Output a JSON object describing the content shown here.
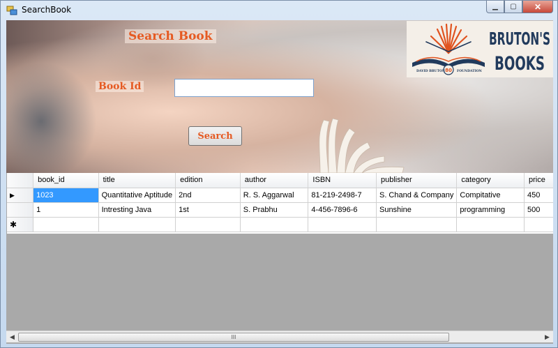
{
  "window": {
    "title": "SearchBook"
  },
  "form": {
    "heading": "Search Book",
    "book_id_label": "Book Id",
    "book_id_value": "",
    "search_label": "Search"
  },
  "logo": {
    "line1": "BRUTON'S",
    "line2": "BOOKS",
    "tagline_left": "DAVID BRUTON",
    "tagline_right": "FOUNDATION",
    "badge": "80"
  },
  "grid": {
    "columns": [
      "book_id",
      "title",
      "edition",
      "author",
      "ISBN",
      "publisher",
      "category",
      "price"
    ],
    "rows": [
      [
        "1023",
        "Quantitative Aptitude",
        "2nd",
        "R. S. Aggarwal",
        "81-219-2498-7",
        "S. Chand & Company",
        "Compitative",
        "450"
      ],
      [
        "1",
        "Intresting Java",
        "1st",
        "S. Prabhu",
        "4-456-7896-6",
        "Sunshine",
        "programming",
        "500"
      ]
    ],
    "new_row_marker": "✱",
    "current_row_marker": "▶"
  },
  "scrollbar": {
    "grip": "III"
  },
  "colors": {
    "accent": "#e55a22",
    "selection": "#3399ff",
    "grid_bg": "#a9a9a9"
  }
}
